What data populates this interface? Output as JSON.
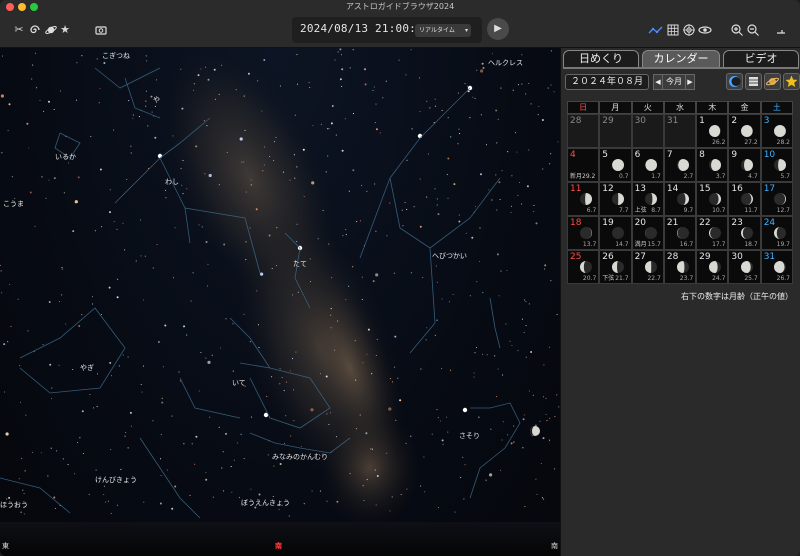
{
  "window": {
    "title": "アストロガイドブラウザ2024"
  },
  "toolbar": {
    "left_icons": [
      "scissors-icon",
      "spiral-icon",
      "planet-icon",
      "star-icon",
      "camera-icon"
    ],
    "datetime": "2024/08/13 21:00:00",
    "mode": "リアルタイム",
    "right_icons": [
      "constellation-icon",
      "grid-icon",
      "target-icon",
      "planet-view-icon",
      "zoom-in-icon",
      "zoom-out-icon",
      "fullscreen-icon"
    ]
  },
  "sky": {
    "constellations": [
      "こぎつね",
      "ヘルクレス",
      "や",
      "いるか",
      "わし",
      "こうま",
      "たて",
      "へびつかい",
      "やぎ",
      "いて",
      "さそり",
      "みなみのかんむり",
      "けんびきょう",
      "ぼうえんきょう",
      "ほうおう"
    ],
    "directions": {
      "east": "東",
      "south": "南",
      "south_right": "南"
    }
  },
  "panel": {
    "tabs": [
      "日めくり",
      "カレンダー",
      "ビデオ"
    ],
    "active_tab": "カレンダー",
    "month": "２０２４年０８月",
    "prev": "◀",
    "today": "今月",
    "next": "▶",
    "view_icons": [
      "moon-view-icon",
      "list-view-icon",
      "planet-calendar-icon",
      "star-calendar-icon"
    ],
    "weekdays": [
      "日",
      "月",
      "火",
      "水",
      "木",
      "金",
      "土"
    ],
    "weeks": [
      [
        {
          "d": "28",
          "o": true
        },
        {
          "d": "29",
          "o": true
        },
        {
          "d": "30",
          "o": true
        },
        {
          "d": "31",
          "o": true
        },
        {
          "d": "1",
          "a": "26.2",
          "ph": 0.07,
          "w": 1
        },
        {
          "d": "2",
          "a": "27.2",
          "ph": 0.03,
          "w": 1
        },
        {
          "d": "3",
          "a": "28.2",
          "ph": 0.01,
          "w": 1
        }
      ],
      [
        {
          "d": "4",
          "a": "",
          "p": "新月",
          "a2": "29.2",
          "ph": 0.0,
          "w": 0
        },
        {
          "d": "5",
          "a": "0.7",
          "ph": 0.01,
          "w": 0
        },
        {
          "d": "6",
          "a": "1.7",
          "ph": 0.04,
          "w": 0
        },
        {
          "d": "7",
          "a": "2.7",
          "ph": 0.1,
          "w": 0
        },
        {
          "d": "8",
          "a": "3.7",
          "ph": 0.17,
          "w": 0
        },
        {
          "d": "9",
          "a": "4.7",
          "ph": 0.25,
          "w": 0
        },
        {
          "d": "10",
          "a": "5.7",
          "ph": 0.34,
          "w": 0
        }
      ],
      [
        {
          "d": "11",
          "a": "6.7",
          "ph": 0.43,
          "w": 0
        },
        {
          "d": "12",
          "a": "7.7",
          "ph": 0.52,
          "w": 0
        },
        {
          "d": "13",
          "p": "上弦",
          "a": "8.7",
          "ph": 0.62,
          "w": 0
        },
        {
          "d": "14",
          "a": "9.7",
          "ph": 0.71,
          "w": 0
        },
        {
          "d": "15",
          "a": "10.7",
          "ph": 0.8,
          "w": 0
        },
        {
          "d": "16",
          "a": "11.7",
          "ph": 0.87,
          "w": 0
        },
        {
          "d": "17",
          "a": "12.7",
          "ph": 0.93,
          "w": 0
        }
      ],
      [
        {
          "d": "18",
          "a": "13.7",
          "ph": 0.97,
          "w": 0
        },
        {
          "d": "19",
          "a": "14.7",
          "ph": 1.0,
          "w": 0
        },
        {
          "d": "20",
          "p": "満月",
          "a": "15.7",
          "ph": 0.99,
          "w": 1
        },
        {
          "d": "21",
          "a": "16.7",
          "ph": 0.96,
          "w": 1
        },
        {
          "d": "22",
          "a": "17.7",
          "ph": 0.91,
          "w": 1
        },
        {
          "d": "23",
          "a": "18.7",
          "ph": 0.85,
          "w": 1
        },
        {
          "d": "24",
          "a": "19.7",
          "ph": 0.77,
          "w": 1
        }
      ],
      [
        {
          "d": "25",
          "a": "20.7",
          "ph": 0.68,
          "w": 1
        },
        {
          "d": "26",
          "p": "下弦",
          "a": "21.7",
          "ph": 0.58,
          "w": 1
        },
        {
          "d": "27",
          "a": "22.7",
          "ph": 0.48,
          "w": 1
        },
        {
          "d": "28",
          "a": "23.7",
          "ph": 0.38,
          "w": 1
        },
        {
          "d": "29",
          "a": "24.7",
          "ph": 0.28,
          "w": 1
        },
        {
          "d": "30",
          "a": "25.7",
          "ph": 0.19,
          "w": 1
        },
        {
          "d": "31",
          "a": "26.7",
          "ph": 0.12,
          "w": 1
        }
      ]
    ],
    "note": "右下の数字は月齢（正午の値）"
  }
}
